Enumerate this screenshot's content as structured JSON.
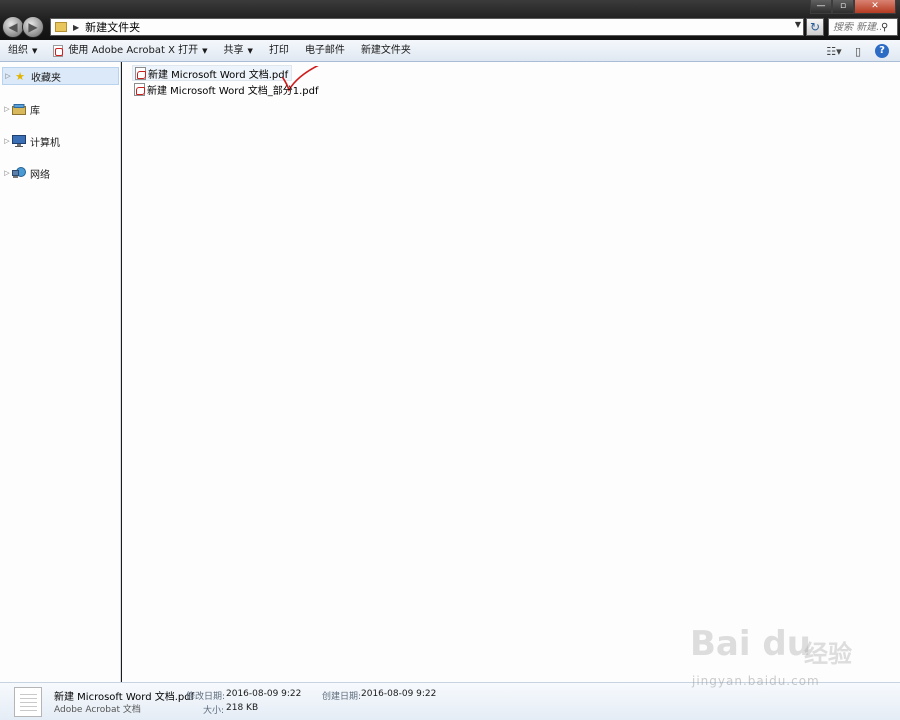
{
  "address": {
    "breadcrumb": "新建文件夹",
    "search_placeholder": "搜索 新建..."
  },
  "window_controls": {
    "minimize": "—",
    "maximize": "▫",
    "close": "✕"
  },
  "toolbar": {
    "organize": "组织",
    "open_with": "使用 Adobe Acrobat X 打开",
    "share": "共享",
    "print": "打印",
    "email": "电子邮件",
    "new_folder": "新建文件夹"
  },
  "sidebar": {
    "items": [
      {
        "label": "收藏夹",
        "icon": "star-icon"
      },
      {
        "label": "库",
        "icon": "library-icon"
      },
      {
        "label": "计算机",
        "icon": "computer-icon"
      },
      {
        "label": "网络",
        "icon": "network-icon"
      }
    ]
  },
  "files": [
    {
      "name": "新建 Microsoft Word 文档.pdf",
      "icon": "pdf-icon",
      "selected": true
    },
    {
      "name": "新建 Microsoft Word 文档_部分1.pdf",
      "icon": "pdf-icon",
      "selected": false
    }
  ],
  "details": {
    "name": "新建 Microsoft Word 文档.pdf",
    "type": "Adobe Acrobat 文档",
    "modified_label": "修改日期:",
    "modified_value": "2016-08-09 9:22",
    "created_label": "创建日期:",
    "created_value": "2016-08-09 9:22",
    "size_label": "大小:",
    "size_value": "218 KB"
  },
  "watermark": {
    "brand": "Bai du",
    "product": "经验",
    "url": "jingyan.baidu.com"
  },
  "colors": {
    "accent": "#2d6cc5",
    "selection": "#dbe9f8",
    "pdf_red": "#c8201e",
    "annotation_red": "#d11a1a"
  }
}
